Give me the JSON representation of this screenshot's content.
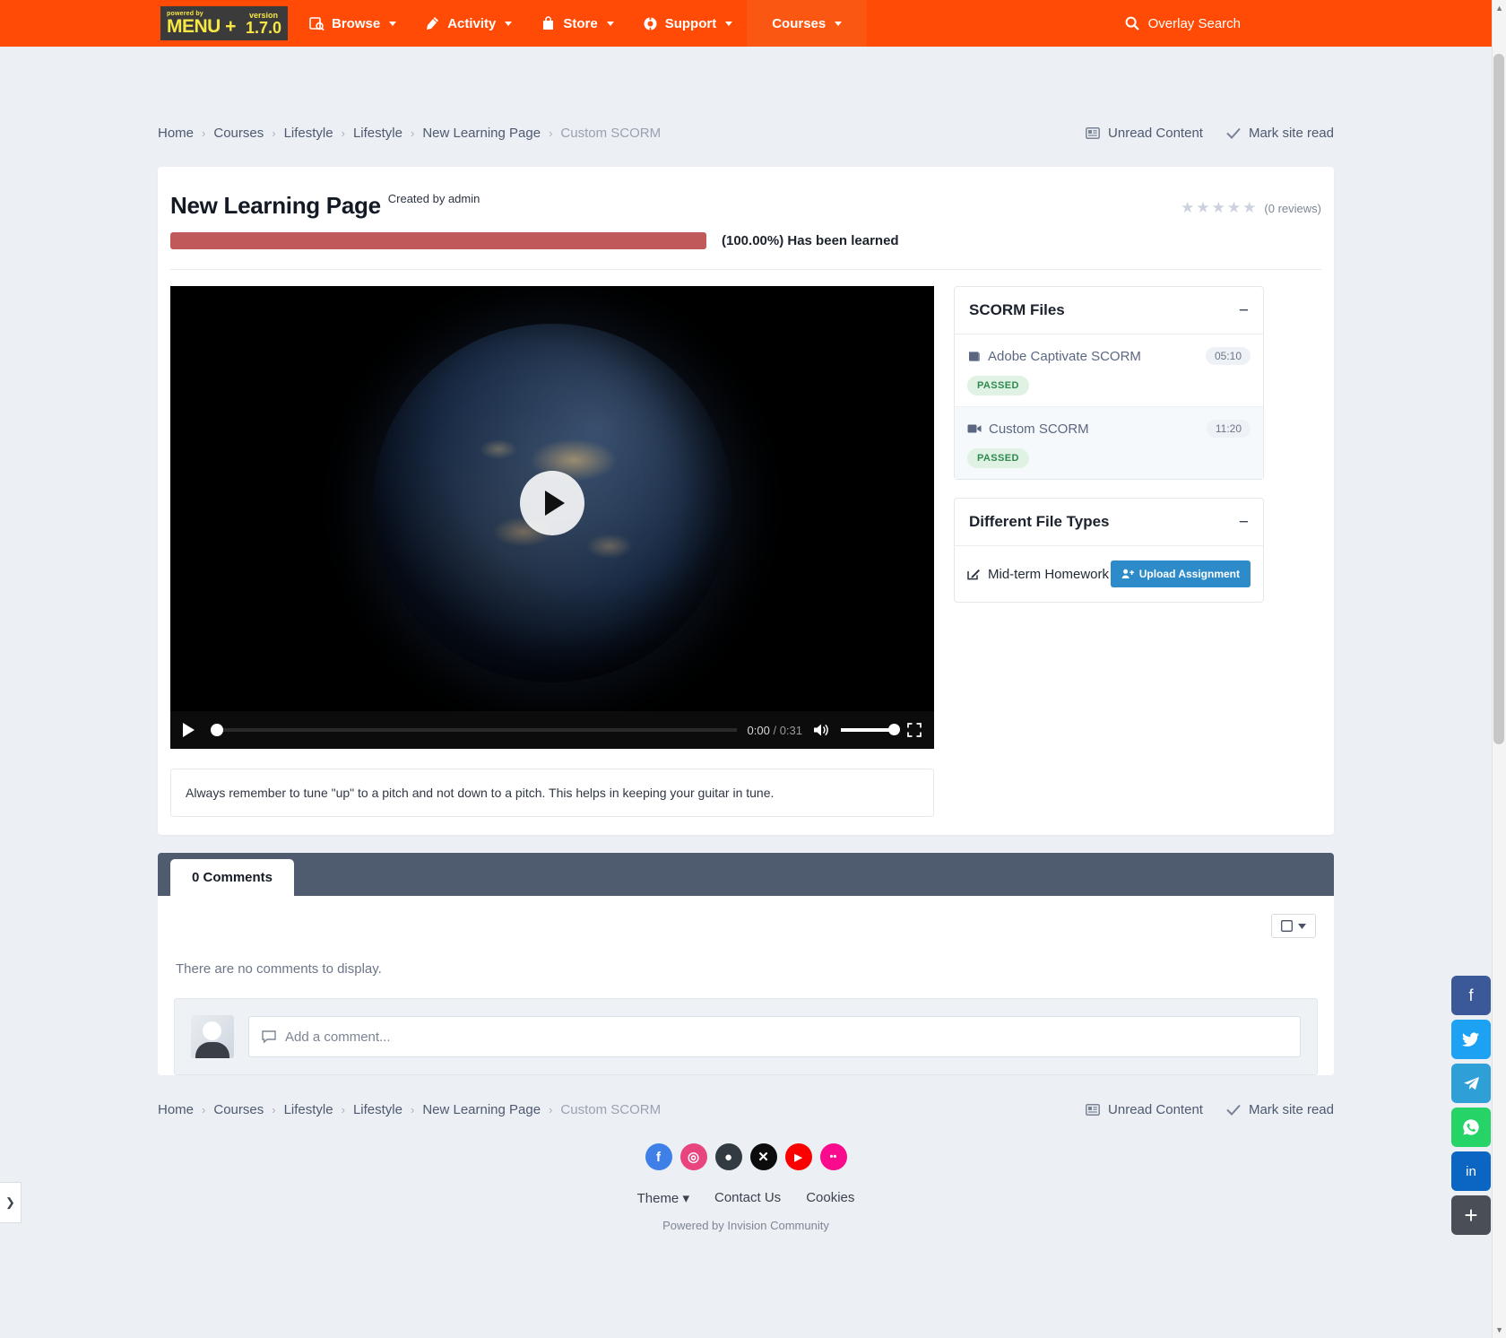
{
  "nav": {
    "logo": {
      "powered": "powered by",
      "menu": "MENU +",
      "version_label": "version",
      "version": "1.7.0"
    },
    "items": [
      {
        "label": "Browse",
        "icon": "browse-icon"
      },
      {
        "label": "Activity",
        "icon": "activity-icon"
      },
      {
        "label": "Store",
        "icon": "store-icon"
      },
      {
        "label": "Support",
        "icon": "support-icon"
      },
      {
        "label": "Courses",
        "icon": "none"
      }
    ],
    "search_label": "Overlay Search"
  },
  "breadcrumb": {
    "items": [
      "Home",
      "Courses",
      "Lifestyle",
      "Lifestyle",
      "New Learning Page"
    ],
    "current": "Custom SCORM",
    "unread": "Unread Content",
    "mark_read": "Mark site read"
  },
  "page": {
    "title": "New Learning Page",
    "created_by": "Created by admin",
    "reviews": "(0 reviews)",
    "stars": 5,
    "stars_filled": 0,
    "progress_percent": "100.00",
    "progress_text": "(100.00%) Has been learned"
  },
  "video": {
    "current_time": "0:00",
    "separator": "/",
    "total_time": "0:31",
    "caption": "Always remember to tune \"up\" to a pitch and not down to a pitch. This helps in keeping your guitar in tune."
  },
  "scorm_panel": {
    "title": "SCORM Files",
    "collapse_icon": "minus-icon",
    "files": [
      {
        "name": "Adobe Captivate SCORM",
        "icon": "book-icon",
        "time": "05:10",
        "status": "PASSED"
      },
      {
        "name": "Custom SCORM",
        "icon": "video-icon",
        "time": "11:20",
        "status": "PASSED"
      }
    ]
  },
  "file_types_panel": {
    "title": "Different File Types",
    "collapse_icon": "minus-icon",
    "items": [
      {
        "name": "Mid-term Homework",
        "icon": "edit-icon",
        "button": "Upload Assignment"
      }
    ]
  },
  "comments": {
    "tab_label": "0 Comments",
    "empty_text": "There are no comments to display.",
    "reply_placeholder": "Add a comment...",
    "filter_icon": "square-dropdown-icon"
  },
  "footer": {
    "social": [
      {
        "name": "facebook",
        "glyph": "f",
        "color": "#3e7fe8"
      },
      {
        "name": "instagram",
        "glyph": "◎",
        "color": "#e8447e"
      },
      {
        "name": "github",
        "glyph": "●",
        "color": "#333b42"
      },
      {
        "name": "x-twitter",
        "glyph": "✕",
        "color": "#0c0c0c"
      },
      {
        "name": "youtube",
        "glyph": "▶",
        "color": "#fa0000"
      },
      {
        "name": "flickr",
        "glyph": "••",
        "color": "#fa0a8c"
      }
    ],
    "links": [
      "Theme",
      "Contact Us",
      "Cookies"
    ],
    "powered": "Powered by Invision Community"
  },
  "share_rail": [
    {
      "name": "facebook-share",
      "glyph": "f",
      "color": "#3b5998"
    },
    {
      "name": "twitter-share",
      "glyph": "ᵕ",
      "color": "#1da1f2"
    },
    {
      "name": "telegram-share",
      "glyph": "➤",
      "color": "#2f9fd8"
    },
    {
      "name": "whatsapp-share",
      "glyph": "✆",
      "color": "#25d366"
    },
    {
      "name": "linkedin-share",
      "glyph": "in",
      "color": "#0a66c2"
    },
    {
      "name": "more-share",
      "glyph": "+",
      "color": "#4a4f57"
    }
  ],
  "colors": {
    "brand": "#ff4b06",
    "progress": "#c05a5a",
    "accent": "#2e8bc9",
    "passed": "#2f8a4f"
  }
}
